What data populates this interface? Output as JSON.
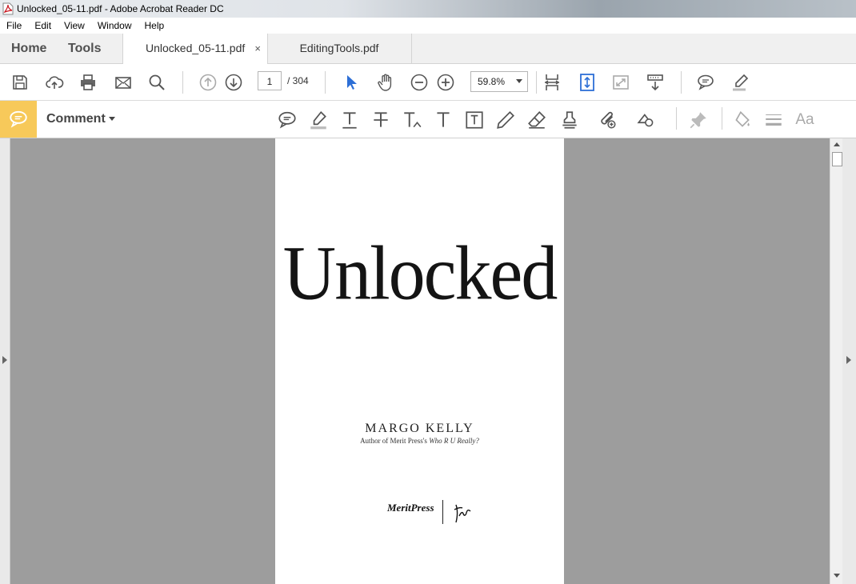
{
  "window": {
    "title": "Unlocked_05-11.pdf - Adobe Acrobat Reader DC"
  },
  "menu": [
    "File",
    "Edit",
    "View",
    "Window",
    "Help"
  ],
  "nav_tabs": {
    "home": "Home",
    "tools": "Tools"
  },
  "doc_tabs": [
    {
      "label": "Unlocked_05-11.pdf",
      "active": true,
      "close": "×"
    },
    {
      "label": "EditingTools.pdf",
      "active": false
    }
  ],
  "toolbar": {
    "page_current": "1",
    "page_total": "/  304",
    "zoom": "59.8%",
    "icons": [
      "save-icon",
      "upload-icon",
      "print-icon",
      "email-icon",
      "search-icon",
      "prev-page-icon",
      "next-page-icon",
      "select-cursor-icon",
      "hand-icon",
      "zoom-out-icon",
      "zoom-in-icon",
      "fit-page-icon",
      "rotate-view-icon",
      "fullscreen-icon",
      "read-mode-icon",
      "comment-icon",
      "highlight-pen-icon"
    ]
  },
  "comment_bar": {
    "label": "Comment",
    "icons": [
      "sticky-note-icon",
      "highlight-icon",
      "underline-text-icon",
      "strikethrough-icon",
      "replace-text-icon",
      "insert-text-icon",
      "text-box-icon",
      "pencil-icon",
      "eraser-icon",
      "stamp-icon",
      "attach-icon",
      "shapes-icon",
      "pin-icon",
      "fill-color-icon",
      "line-weight-icon",
      "font-icon"
    ],
    "font_label": "Aa"
  },
  "document": {
    "title": "Unlocked",
    "author": "MARGO KELLY",
    "author_note_prefix": "Author of Merit Press's",
    "author_note_book": "Who R U Really?",
    "publisher": "MeritPress"
  },
  "colors": {
    "comment_badge": "#f7c95a",
    "select_blue": "#2d6fd6",
    "doc_gray": "#9d9d9d"
  }
}
